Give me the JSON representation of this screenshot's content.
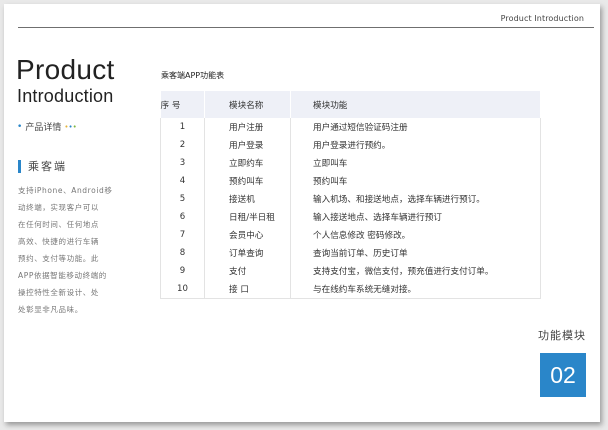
{
  "header": {
    "label": "Product Introduction"
  },
  "title": {
    "line1": "Product",
    "line2": "Introduction",
    "detail": "产品详情"
  },
  "sidebar": {
    "heading": "乘客端",
    "lines": [
      "支持iPhone、Android移",
      "动终端，实现客户可以",
      "在任何时间、任何地点",
      "高效、快捷的进行车辆",
      "预约、支付等功能。此",
      "APP依据智能移动终端的",
      "操控特性全新设计、处",
      "处彰显非凡品味。"
    ]
  },
  "table": {
    "caption": "乘客端APP功能表",
    "headers": [
      "序 号",
      "模块名称",
      "模块功能"
    ],
    "rows": [
      [
        "1",
        "用户注册",
        "用户通过短信验证码注册"
      ],
      [
        "2",
        "用户登录",
        "用户登录进行预约。"
      ],
      [
        "3",
        "立即约车",
        "立即叫车"
      ],
      [
        "4",
        "预约叫车",
        "预约叫车"
      ],
      [
        "5",
        "接送机",
        "输入机场、和接送地点，选择车辆进行预订。"
      ],
      [
        "6",
        "日租/半日租",
        "输入接送地点、选择车辆进行预订"
      ],
      [
        "7",
        "会员中心",
        "个人信息修改 密码修改。"
      ],
      [
        "8",
        "订单查询",
        "查询当前订单、历史订单"
      ],
      [
        "9",
        "支付",
        "支持支付宝，微信支付，预充值进行支付订单。"
      ],
      [
        "10",
        "接 口",
        "与在线约车系统无缝对接。"
      ]
    ]
  },
  "module": {
    "label": "功能模块",
    "number": "02"
  },
  "colors": {
    "accent": "#2a86c9",
    "header_bg": "#eef0f7"
  }
}
